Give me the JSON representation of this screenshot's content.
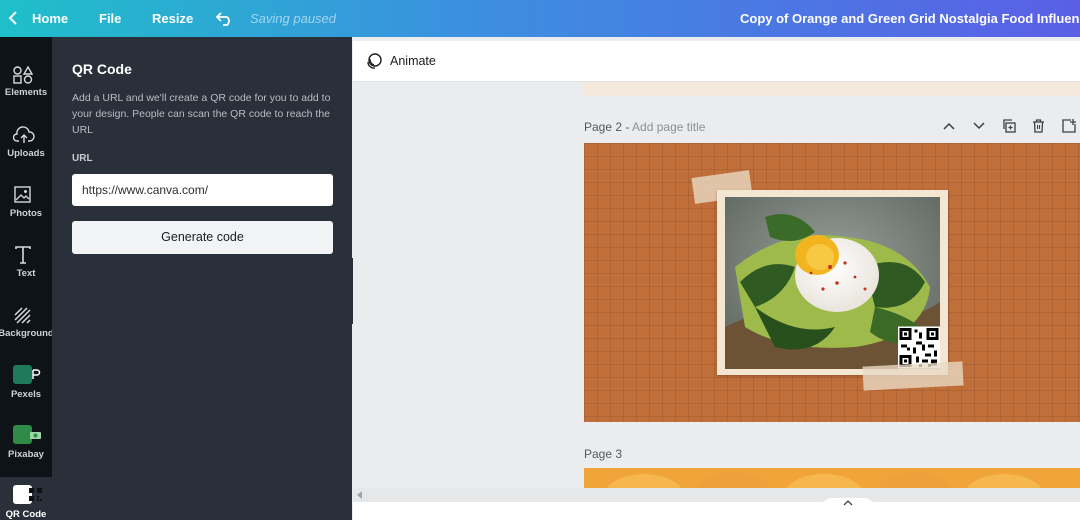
{
  "topbar": {
    "home_label": "Home",
    "file_label": "File",
    "resize_label": "Resize",
    "status": "Saving paused",
    "document_title": "Copy of Orange and Green Grid Nostalgia Food Influencer F..."
  },
  "rail": {
    "items": [
      {
        "label": "Elements",
        "icon": "shapes-icon"
      },
      {
        "label": "Uploads",
        "icon": "cloud-upload-icon"
      },
      {
        "label": "Photos",
        "icon": "image-icon"
      },
      {
        "label": "Text",
        "icon": "text-icon"
      },
      {
        "label": "Background",
        "icon": "hatch-pattern-icon"
      },
      {
        "label": "Pexels",
        "icon": "pexels-logo-icon"
      },
      {
        "label": "Pixabay",
        "icon": "pixabay-logo-icon"
      },
      {
        "label": "QR Code",
        "icon": "qr-code-icon"
      }
    ],
    "active": "QR Code"
  },
  "panel": {
    "title": "QR Code",
    "description": "Add a URL and we'll create a QR code for you to add to your design. People can scan the QR code to reach the URL",
    "url_label": "URL",
    "url_value": "https://www.canva.com/",
    "generate_label": "Generate code"
  },
  "canvas": {
    "animate_label": "Animate",
    "page2_label": "Page 2 - ",
    "page2_title_placeholder": "Add page title",
    "page3_label": "Page 3"
  },
  "colors": {
    "gradient_start": "#1fbfc9",
    "gradient_end": "#5a5fe6",
    "panel_bg": "#293039",
    "rail_bg": "#0e1318",
    "page_bg": "#c06f3b"
  }
}
